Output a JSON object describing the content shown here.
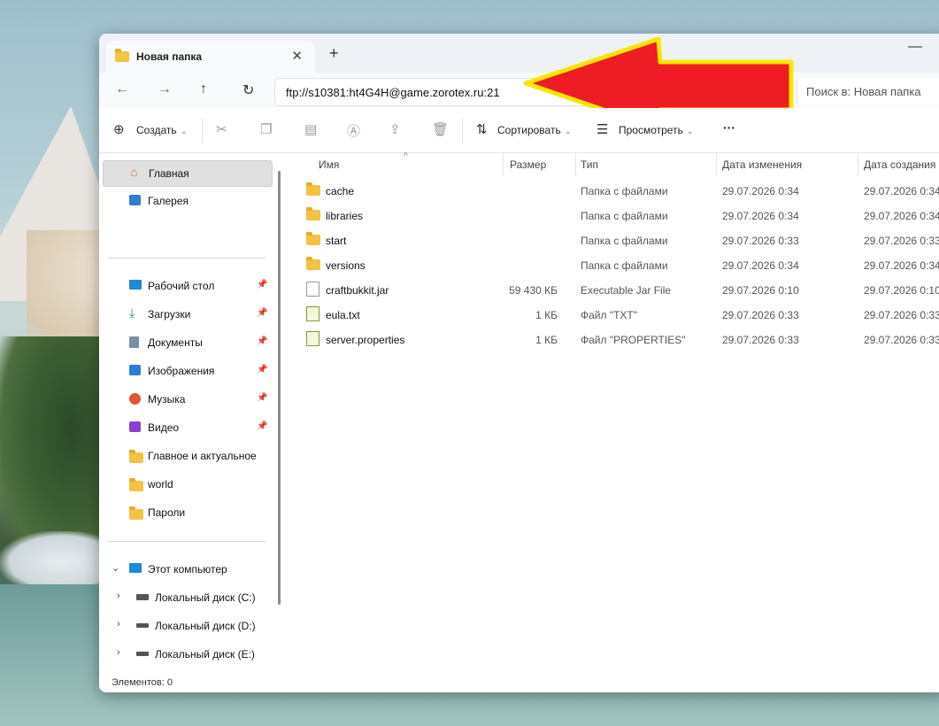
{
  "window": {
    "tab_title": "Новая папка",
    "close_glyph": "✕",
    "newtab_glyph": "+",
    "minimize_glyph": "—"
  },
  "nav": {
    "back_glyph": "←",
    "forward_glyph": "→",
    "up_glyph": "↑",
    "refresh_glyph": "↻",
    "address": "ftp://s10381:ht4G4H@game.zorotex.ru:21",
    "search_placeholder": "Поиск в: Новая папка"
  },
  "toolbar": {
    "create_label": "Создать",
    "sort_label": "Сортировать",
    "view_label": "Просмотреть",
    "more_glyph": "···"
  },
  "sidebar": {
    "top": [
      {
        "label": "Главная",
        "icon": "home-icon"
      },
      {
        "label": "Галерея",
        "icon": "gallery-icon"
      }
    ],
    "quick": [
      {
        "label": "Рабочий стол",
        "icon": "desktop-icon"
      },
      {
        "label": "Загрузки",
        "icon": "downloads-icon"
      },
      {
        "label": "Документы",
        "icon": "documents-icon"
      },
      {
        "label": "Изображения",
        "icon": "pictures-icon"
      },
      {
        "label": "Музыка",
        "icon": "music-icon"
      },
      {
        "label": "Видео",
        "icon": "video-icon"
      },
      {
        "label": "Главное и актуальное",
        "icon": "folder-icon"
      },
      {
        "label": "world",
        "icon": "folder-icon"
      },
      {
        "label": "Пароли",
        "icon": "folder-icon"
      }
    ],
    "computer": {
      "label": "Этот компьютер",
      "icon": "computer-icon"
    },
    "drives": [
      {
        "label": "Локальный диск (C:)"
      },
      {
        "label": "Локальный диск (D:)"
      },
      {
        "label": "Локальный диск (E:)"
      }
    ]
  },
  "columns": {
    "name": "Имя",
    "size": "Размер",
    "type": "Тип",
    "modified": "Дата изменения",
    "created": "Дата создания"
  },
  "files": [
    {
      "name": "cache",
      "size": "",
      "type": "Папка с файлами",
      "modified": "29.07.2026 0:34",
      "created": "29.07.2026 0:34",
      "icon": "folder-icon"
    },
    {
      "name": "libraries",
      "size": "",
      "type": "Папка с файлами",
      "modified": "29.07.2026 0:34",
      "created": "29.07.2026 0:34",
      "icon": "folder-icon"
    },
    {
      "name": "start",
      "size": "",
      "type": "Папка с файлами",
      "modified": "29.07.2026 0:33",
      "created": "29.07.2026 0:33",
      "icon": "folder-icon"
    },
    {
      "name": "versions",
      "size": "",
      "type": "Папка с файлами",
      "modified": "29.07.2026 0:34",
      "created": "29.07.2026 0:34",
      "icon": "folder-icon"
    },
    {
      "name": "craftbukkit.jar",
      "size": "59 430 КБ",
      "type": "Executable Jar File",
      "modified": "29.07.2026 0:10",
      "created": "29.07.2026 0:10",
      "icon": "jar-icon"
    },
    {
      "name": "eula.txt",
      "size": "1 КБ",
      "type": "Файл \"TXT\"",
      "modified": "29.07.2026 0:33",
      "created": "29.07.2026 0:33",
      "icon": "text-file-icon"
    },
    {
      "name": "server.properties",
      "size": "1 КБ",
      "type": "Файл \"PROPERTIES\"",
      "modified": "29.07.2026 0:33",
      "created": "29.07.2026 0:33",
      "icon": "text-file-icon"
    }
  ],
  "status": {
    "items": "Элементов: 0"
  },
  "colors": {
    "arrow_fill": "#ee1c24",
    "arrow_outline": "#ffe600",
    "folder": "#f6c243",
    "accent": "#0067c0"
  }
}
